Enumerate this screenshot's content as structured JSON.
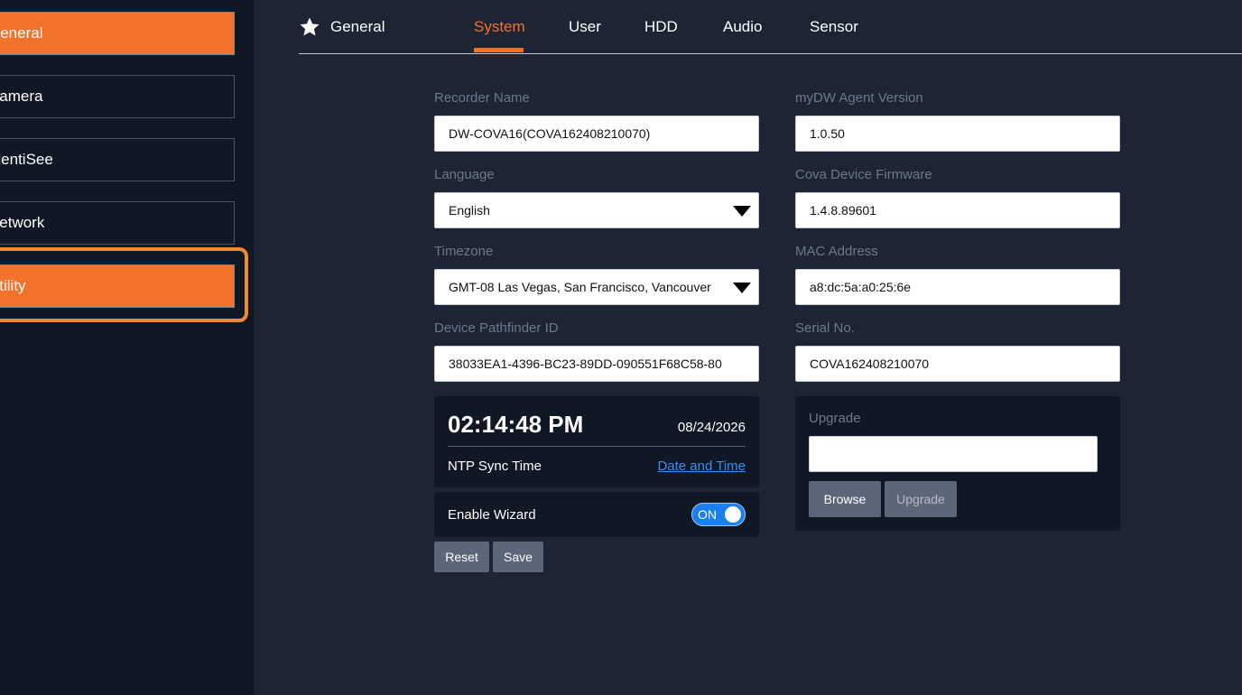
{
  "sidebar": {
    "items": [
      {
        "label": "General",
        "active": true
      },
      {
        "label": "Camera",
        "active": false
      },
      {
        "label": "IdentiSee",
        "active": false
      },
      {
        "label": "Network",
        "active": false
      },
      {
        "label": "Utility",
        "active": true
      }
    ]
  },
  "header": {
    "section_icon": "star-icon",
    "section_title": "General",
    "tabs": [
      {
        "label": "System",
        "active": true
      },
      {
        "label": "User",
        "active": false
      },
      {
        "label": "HDD",
        "active": false
      },
      {
        "label": "Audio",
        "active": false
      },
      {
        "label": "Sensor",
        "active": false
      }
    ]
  },
  "form": {
    "recorder_name": {
      "label": "Recorder Name",
      "value": "DW-COVA16(COVA162408210070)"
    },
    "language": {
      "label": "Language",
      "value": "English"
    },
    "timezone": {
      "label": "Timezone",
      "value": "GMT-08 Las Vegas, San Francisco, Vancouver"
    },
    "pathfinder": {
      "label": "Device Pathfinder ID",
      "value": "38033EA1-4396-BC23-89DD-090551F68C58-80"
    },
    "agent_version": {
      "label": "myDW Agent Version",
      "value": "1.0.50"
    },
    "firmware": {
      "label": "Cova Device Firmware",
      "value": "1.4.8.89601"
    },
    "mac": {
      "label": "MAC Address",
      "value": "a8:dc:5a:a0:25:6e"
    },
    "serial": {
      "label": "Serial No.",
      "value": "COVA162408210070"
    }
  },
  "clock": {
    "time": "02:14:48 PM",
    "date": "08/24/2026",
    "ntp_label": "NTP Sync Time",
    "link_label": "Date and Time"
  },
  "wizard": {
    "label": "Enable Wizard",
    "toggle": "ON",
    "enabled": true
  },
  "actions": {
    "reset": "Reset",
    "save": "Save"
  },
  "upgrade": {
    "label": "Upgrade",
    "file_value": "",
    "browse": "Browse",
    "upgrade_button": "Upgrade"
  },
  "colors": {
    "accent": "#f2722a",
    "sidebar_bg": "#101725",
    "main_bg": "#1d2535",
    "link": "#3b8cf0",
    "toggle": "#1a7ff0"
  }
}
